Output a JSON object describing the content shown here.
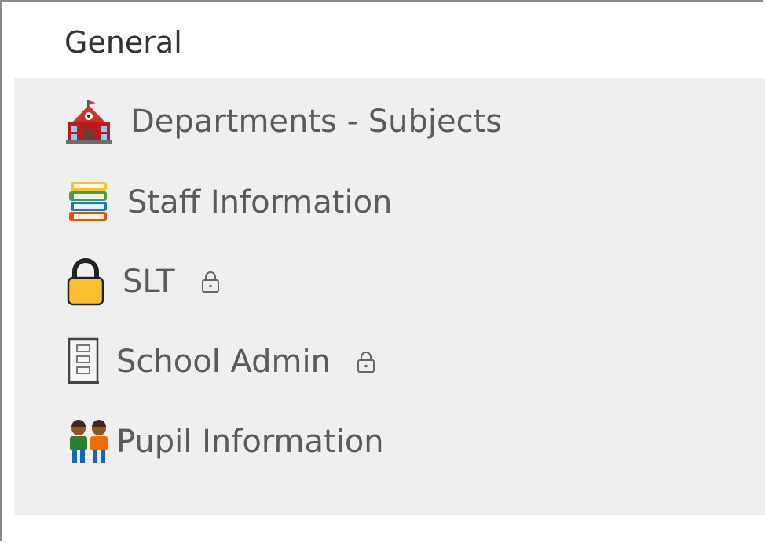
{
  "team": {
    "section_title": "General"
  },
  "channels": [
    {
      "label": "Departments - Subjects",
      "icon": "school-building-icon",
      "locked": false
    },
    {
      "label": "Staff Information",
      "icon": "books-stack-icon",
      "locked": false
    },
    {
      "label": "SLT",
      "icon": "yellow-lock-icon",
      "locked": true
    },
    {
      "label": "School Admin",
      "icon": "filing-cabinet-icon",
      "locked": true
    },
    {
      "label": "Pupil Information",
      "icon": "two-children-icon",
      "locked": false
    }
  ],
  "colors": {
    "panel_background": "#efefef",
    "text": "#5b5b5b",
    "title_text": "#333333",
    "frame_border": "#8a8a8a"
  }
}
